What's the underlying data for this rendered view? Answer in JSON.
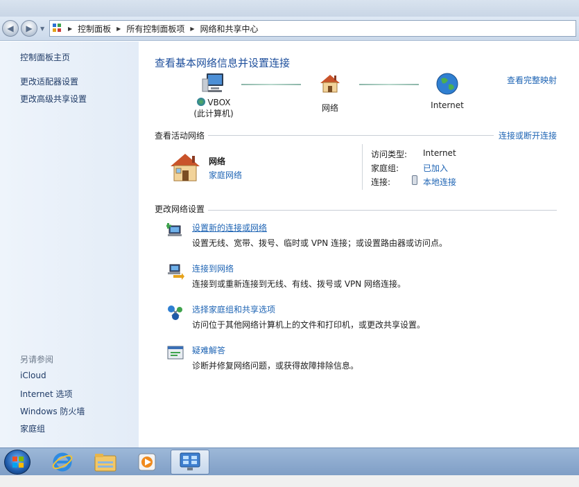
{
  "address": {
    "crumbs": [
      "控制面板",
      "所有控制面板项",
      "网络和共享中心"
    ]
  },
  "sidebar": {
    "items": [
      {
        "label": "控制面板主页"
      },
      {
        "label": "更改适配器设置"
      },
      {
        "label": "更改高级共享设置"
      }
    ],
    "see_also_label": "另请参阅",
    "see_also": [
      {
        "label": "iCloud"
      },
      {
        "label": "Internet 选项"
      },
      {
        "label": "Windows 防火墙"
      },
      {
        "label": "家庭组"
      }
    ]
  },
  "main": {
    "title": "查看基本网络信息并设置连接",
    "view_full_map": "查看完整映射",
    "map": {
      "computer_name": "VBOX",
      "computer_sub": "(此计算机)",
      "network_label": "网络",
      "internet_label": "Internet"
    },
    "active_networks": {
      "header": "查看活动网络",
      "connect_disconnect": "连接或断开连接",
      "network_name": "网络",
      "network_type": "家庭网络",
      "access_type_label": "访问类型:",
      "access_type_value": "Internet",
      "homegroup_label": "家庭组:",
      "homegroup_value": "已加入",
      "connections_label": "连接:",
      "connections_value": "本地连接"
    },
    "change_settings": {
      "header": "更改网络设置",
      "tasks": [
        {
          "title": "设置新的连接或网络",
          "desc": "设置无线、宽带、拨号、临时或 VPN 连接；或设置路由器或访问点。"
        },
        {
          "title": "连接到网络",
          "desc": "连接到或重新连接到无线、有线、拨号或 VPN 网络连接。"
        },
        {
          "title": "选择家庭组和共享选项",
          "desc": "访问位于其他网络计算机上的文件和打印机，或更改共享设置。"
        },
        {
          "title": "疑难解答",
          "desc": "诊断并修复网络问题，或获得故障排除信息。"
        }
      ]
    }
  },
  "taskbar": {
    "items": [
      "start-orb",
      "internet-explorer-icon",
      "windows-explorer-icon",
      "media-player-icon",
      "control-panel-icon"
    ]
  }
}
